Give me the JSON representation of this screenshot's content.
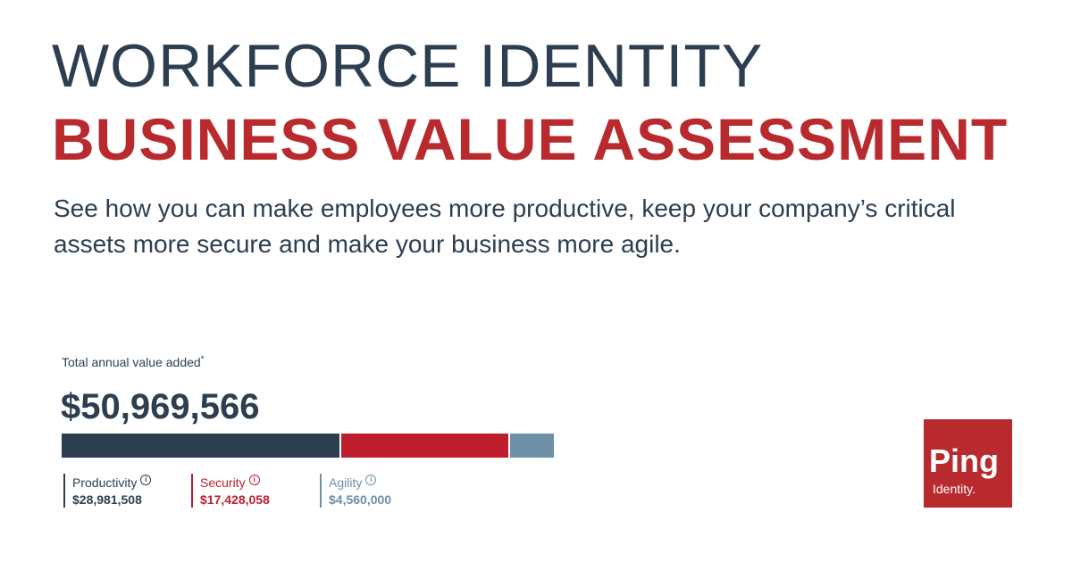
{
  "header": {
    "title": "WORKFORCE IDENTITY",
    "subtitle": "BUSINESS VALUE ASSESSMENT",
    "description": "See how you can make employees more productive, keep your company’s critical assets more secure and make your business more agile."
  },
  "summary": {
    "label": "Total annual value added",
    "footnote_mark": "*",
    "total": "$50,969,566",
    "segments": [
      {
        "name": "Productivity",
        "value": "$28,981,508",
        "amount": 28981508,
        "color": "#2d3e50",
        "icon": "info-icon"
      },
      {
        "name": "Security",
        "value": "$17,428,058",
        "amount": 17428058,
        "color": "#be1e2d",
        "icon": "info-icon"
      },
      {
        "name": "Agility",
        "value": "$4,560,000",
        "amount": 4560000,
        "color": "#6d8fa8",
        "icon": "info-icon"
      }
    ]
  },
  "brand": {
    "logo_text_1": "Ping",
    "logo_text_2": "Identity.",
    "logo_color": "#b82a2e"
  }
}
